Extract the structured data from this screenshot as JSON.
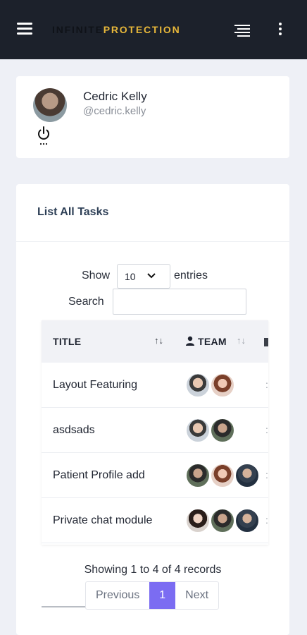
{
  "header": {
    "brand_part1": "INFINITE",
    "brand_part2": "PROTECTION",
    "menu_icon": "hamburger-icon",
    "view_icon": "lines-icon",
    "more_icon": "kebab-icon"
  },
  "profile": {
    "name": "Cedric Kelly",
    "handle": "@cedric.kelly",
    "power_icon": "power-icon"
  },
  "tasks": {
    "title": "List All Tasks",
    "show_label": "Show",
    "page_size": "10",
    "entries_label": "entries",
    "search_label": "Search",
    "search_value": "",
    "columns": [
      "TITLE",
      "TEAM"
    ],
    "rows": [
      {
        "title": "Layout Featuring",
        "team_count": 2
      },
      {
        "title": "asdsads",
        "team_count": 2
      },
      {
        "title": "Patient Profile add",
        "team_count": 3
      },
      {
        "title": "Private chat module",
        "team_count": 3
      }
    ],
    "info": "Showing 1 to 4 of 4 records",
    "pagination": {
      "previous": "Previous",
      "current": "1",
      "next": "Next"
    }
  },
  "colors": {
    "topbar": "#1c212b",
    "brand_accent": "#e8b83a",
    "page_bg": "#eef0f6",
    "pager_active": "#7b6cf2"
  }
}
